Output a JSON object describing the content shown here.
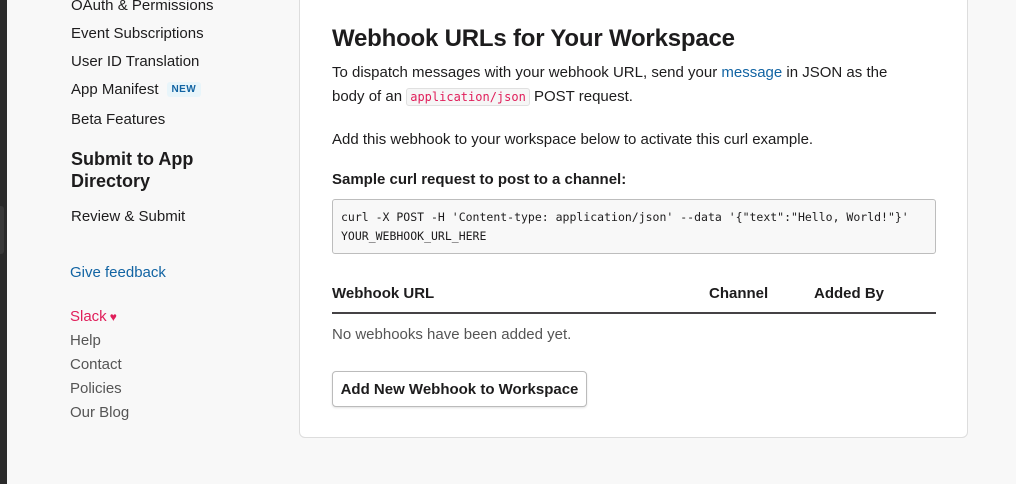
{
  "sidebar": {
    "items": [
      {
        "label": "OAuth & Permissions"
      },
      {
        "label": "Event Subscriptions"
      },
      {
        "label": "User ID Translation"
      },
      {
        "label": "App Manifest",
        "badge": "NEW"
      },
      {
        "label": "Beta Features"
      }
    ],
    "section_heading": "Submit to App Directory",
    "section_items": [
      {
        "label": "Review & Submit"
      }
    ],
    "feedback": "Give feedback",
    "footer": [
      {
        "label": "Slack"
      },
      {
        "label": "Help"
      },
      {
        "label": "Contact"
      },
      {
        "label": "Policies"
      },
      {
        "label": "Our Blog"
      }
    ]
  },
  "main": {
    "title": "Webhook URLs for Your Workspace",
    "intro": {
      "part1": "To dispatch messages with your webhook URL, send your ",
      "link": "message",
      "part2": " in JSON as the body of an ",
      "code": "application/json",
      "part3": " POST request."
    },
    "activate_text": "Add this webhook to your workspace below to activate this curl example.",
    "sample_heading": "Sample curl request to post to a channel:",
    "curl": "curl -X POST -H 'Content-type: application/json' --data '{\"text\":\"Hello, World!\"}' YOUR_WEBHOOK_URL_HERE",
    "table": {
      "columns": [
        "Webhook URL",
        "Channel",
        "Added By"
      ],
      "empty": "No webhooks have been added yet."
    },
    "add_button": "Add New Webhook to Workspace"
  }
}
